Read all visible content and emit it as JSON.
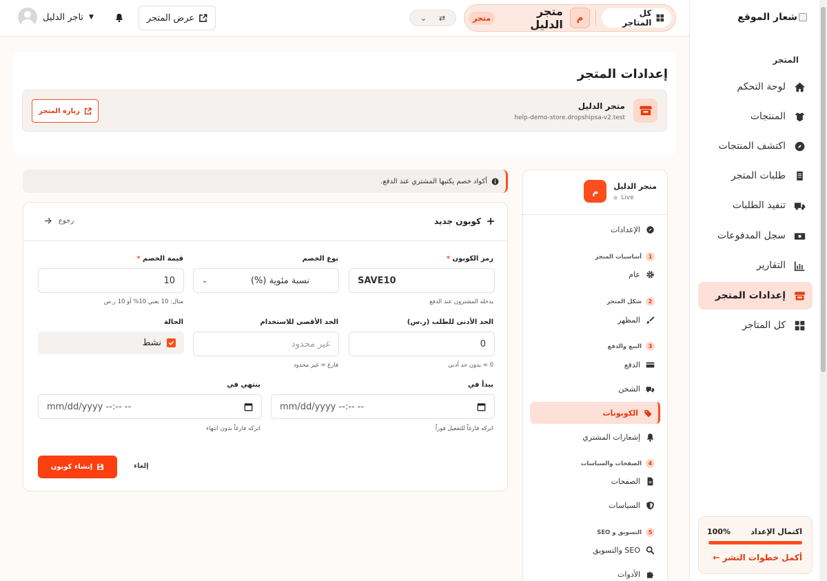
{
  "sidebar": {
    "logo_alt": "شعار الموقع",
    "section": "المتجر",
    "items": [
      {
        "label": "لوحة التحكم",
        "icon": "home-icon"
      },
      {
        "label": "المنتجات",
        "icon": "boxes-icon"
      },
      {
        "label": "اكتشف المنتجات",
        "icon": "compass-icon"
      },
      {
        "label": "طلبات المتجر",
        "icon": "receipt-icon"
      },
      {
        "label": "تنفيذ الطلبات",
        "icon": "truck-icon"
      },
      {
        "label": "سجل المدفوعات",
        "icon": "money-icon"
      },
      {
        "label": "التقارير",
        "icon": "chart-icon"
      },
      {
        "label": "إعدادات المتجر",
        "icon": "store-icon",
        "active": true
      },
      {
        "label": "كل المتاجر",
        "icon": "grid-icon"
      }
    ],
    "setup": {
      "title": "اكتمال الإعداد",
      "percent": "100%",
      "progress": 1.0,
      "link": "أكمل خطوات النشر ←"
    }
  },
  "topbar": {
    "all_stores": "كل المتاجر",
    "store_avatar": "م",
    "store_name": "متجر الدليل",
    "store_badge": "متجر",
    "view_store": "عرض المتجر",
    "user_name": "تاجر الدليل"
  },
  "page": {
    "title": "إعدادات المتجر",
    "store_name": "متجر الدليل",
    "store_url": "help-demo-store.dropshipsa-v2.test",
    "visit_button": "زيارة المتجر"
  },
  "settings_nav": {
    "avatar": "م",
    "store_name": "متجر الدليل",
    "status": "Live",
    "settings_label": "الإعدادات",
    "groups": [
      {
        "num": "1",
        "label": "أساسيات المتجر"
      },
      {
        "num": "2",
        "label": "شكل المتجر"
      },
      {
        "num": "3",
        "label": "البيع والدفع"
      },
      {
        "num": "4",
        "label": "الصفحات والسياسات"
      },
      {
        "num": "5",
        "label": "التسويق و SEO"
      }
    ],
    "items": {
      "general": "عام",
      "appearance": "المظهر",
      "payment": "الدفع",
      "shipping": "الشحن",
      "coupons": "الكوبونات",
      "notifications": "إشعارات المشتري",
      "pages": "الصفحات",
      "policies": "السياسات",
      "seo": "SEO والتسويق",
      "tools": "الأدوات"
    }
  },
  "info_banner": "أكواد خصم يكتبها المشتري عند الدفع.",
  "coupon_form": {
    "title": "كوبون جديد",
    "back": "رجوع",
    "code": {
      "label": "رمز الكوبون",
      "value": "SAVE10",
      "hint": "يدخله المشترون عند الدفع"
    },
    "type": {
      "label": "نوع الخصم",
      "value": "نسبة مئوية (%)"
    },
    "amount": {
      "label": "قيمة الخصم",
      "value": "10",
      "hint": "مثال: 10 يعني 10% أو 10 ر.س"
    },
    "min_order": {
      "label": "الحد الأدنى للطلب (ر.س)",
      "value": "0",
      "hint": "0 = بدون حد أدنى"
    },
    "max_uses": {
      "label": "الحد الأقصى للاستخدام",
      "placeholder": "غير محدود",
      "hint": "فارغ = غير محدود"
    },
    "status": {
      "label": "الحالة",
      "value": "نشط"
    },
    "starts": {
      "label": "يبدأ في",
      "placeholder": "mm/dd/yyyy --:-- --",
      "hint": "اتركه فارغاً للتفعيل فوراً"
    },
    "ends": {
      "label": "ينتهي في",
      "placeholder": "mm/dd/yyyy --:-- --",
      "hint": "اتركه فارغاً بدون انتهاء"
    },
    "create_button": "إنشاء كوبون",
    "cancel_button": "إلغاء"
  },
  "colors": {
    "accent": "#fb4e1c",
    "accent_light": "#fde0d7",
    "background": "#fdfaf8"
  }
}
